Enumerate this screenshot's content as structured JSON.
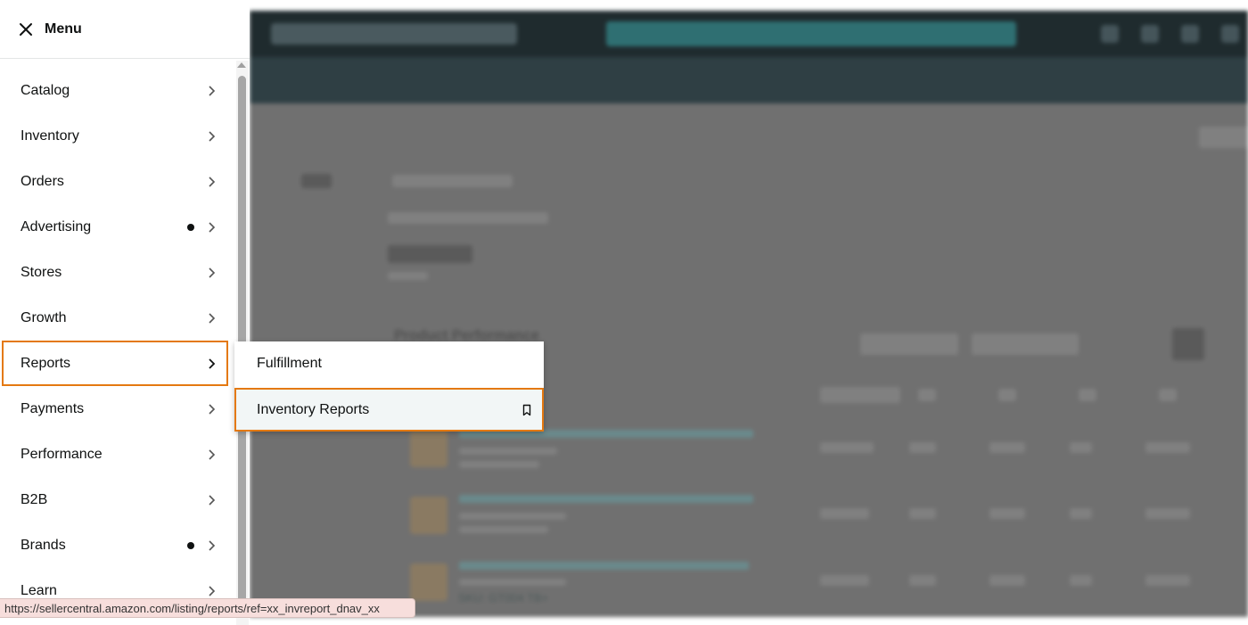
{
  "menu": {
    "title": "Menu",
    "items": [
      {
        "label": "Catalog",
        "dot": false
      },
      {
        "label": "Inventory",
        "dot": false
      },
      {
        "label": "Orders",
        "dot": false
      },
      {
        "label": "Advertising",
        "dot": true
      },
      {
        "label": "Stores",
        "dot": false
      },
      {
        "label": "Growth",
        "dot": false
      },
      {
        "label": "Reports",
        "dot": false,
        "active": true
      },
      {
        "label": "Payments",
        "dot": false
      },
      {
        "label": "Performance",
        "dot": false
      },
      {
        "label": "B2B",
        "dot": false
      },
      {
        "label": "Brands",
        "dot": true
      },
      {
        "label": "Learn",
        "dot": false
      }
    ]
  },
  "submenu": {
    "items": [
      {
        "label": "Fulfillment"
      },
      {
        "label": "Inventory Reports",
        "bookmark": true
      }
    ]
  },
  "background": {
    "section_title": "Product Performance",
    "sku_text": "SKU: GT004 TB+"
  },
  "statusbar": {
    "url": "https://sellercentral.amazon.com/listing/reports/ref=xx_invreport_dnav_xx"
  },
  "colors": {
    "highlight": "#e47911",
    "text": "#0f1111"
  },
  "icons": {
    "close": "close-icon",
    "chevron": "chevron-right-icon",
    "bookmark": "bookmark-icon"
  }
}
